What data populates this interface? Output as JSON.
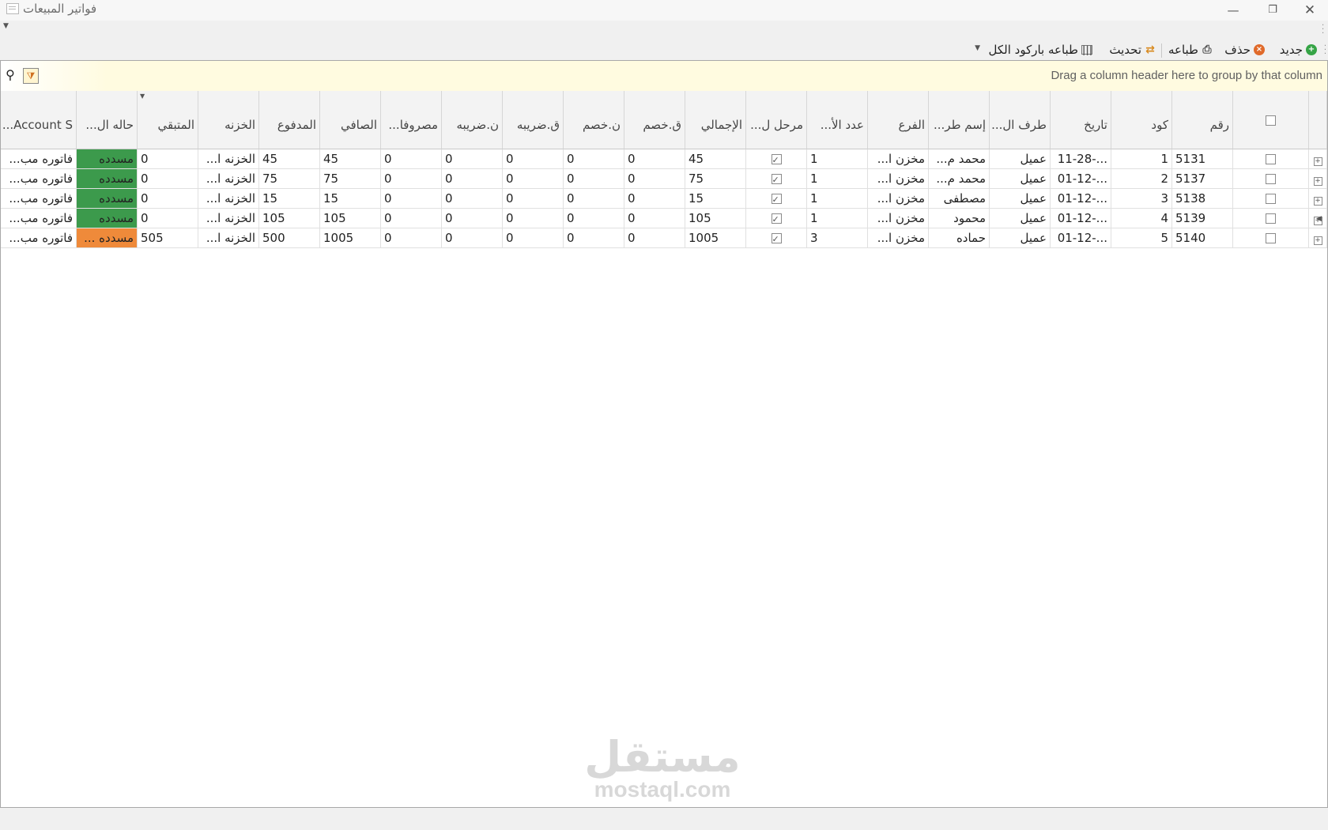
{
  "window": {
    "title": "فواتير المبيعات"
  },
  "toolbar": {
    "new": "جديد",
    "delete": "حذف",
    "print": "طباعه",
    "refresh": "تحديث",
    "barcode_all": "طباعه باركود الكل"
  },
  "grid": {
    "group_hint": "Drag a column header here to group by that column",
    "columns": [
      "رقم",
      "كود",
      "تاريخ",
      "طرف ال...",
      "إسم طر...",
      "الفرع",
      "عدد الأ...",
      "مرحل ل...",
      "الإجمالي",
      "ق.خصم",
      "ن.خصم",
      "ق.ضريبه",
      "ن.ضريبه",
      "مصروفا...",
      "الصافي",
      "المدفوع",
      "الخزنه",
      "المتبقي",
      "حاله ال...",
      "Account S..."
    ],
    "rows": [
      {
        "number": "5131",
        "code": "1",
        "date": "11-28-...",
        "party": "عميل",
        "party_name": "محمد م...",
        "branch": "مخزن ا...",
        "count": "1",
        "posted": true,
        "total": "45",
        "disc_val": "0",
        "disc_pct": "0",
        "tax_val": "0",
        "tax_pct": "0",
        "expenses": "0",
        "net": "45",
        "paid": "45",
        "treasury": "الخزنه ا...",
        "remaining": "0",
        "status": "مسدده",
        "status_color": "#3c9a4c",
        "account": "فاتوره مب..."
      },
      {
        "number": "5137",
        "code": "2",
        "date": "01-12-...",
        "party": "عميل",
        "party_name": "محمد م...",
        "branch": "مخزن ا...",
        "count": "1",
        "posted": true,
        "total": "75",
        "disc_val": "0",
        "disc_pct": "0",
        "tax_val": "0",
        "tax_pct": "0",
        "expenses": "0",
        "net": "75",
        "paid": "75",
        "treasury": "الخزنه ا...",
        "remaining": "0",
        "status": "مسدده",
        "status_color": "#3c9a4c",
        "account": "فاتوره مب..."
      },
      {
        "number": "5138",
        "code": "3",
        "date": "01-12-...",
        "party": "عميل",
        "party_name": "مصطفى",
        "branch": "مخزن ا...",
        "count": "1",
        "posted": true,
        "total": "15",
        "disc_val": "0",
        "disc_pct": "0",
        "tax_val": "0",
        "tax_pct": "0",
        "expenses": "0",
        "net": "15",
        "paid": "15",
        "treasury": "الخزنه ا...",
        "remaining": "0",
        "status": "مسدده",
        "status_color": "#3c9a4c",
        "account": "فاتوره مب..."
      },
      {
        "number": "5139",
        "code": "4",
        "date": "01-12-...",
        "party": "عميل",
        "party_name": "محمود",
        "branch": "مخزن ا...",
        "count": "1",
        "posted": true,
        "total": "105",
        "disc_val": "0",
        "disc_pct": "0",
        "tax_val": "0",
        "tax_pct": "0",
        "expenses": "0",
        "net": "105",
        "paid": "105",
        "treasury": "الخزنه ا...",
        "remaining": "0",
        "status": "مسدده",
        "status_color": "#3c9a4c",
        "account": "فاتوره مب..."
      },
      {
        "number": "5140",
        "code": "5",
        "date": "01-12-...",
        "party": "عميل",
        "party_name": "حماده",
        "branch": "مخزن ا...",
        "count": "3",
        "posted": true,
        "total": "1005",
        "disc_val": "0",
        "disc_pct": "0",
        "tax_val": "0",
        "tax_pct": "0",
        "expenses": "0",
        "net": "1005",
        "paid": "500",
        "treasury": "الخزنه ا...",
        "remaining": "505",
        "status": "مسدده ...",
        "status_color": "#ef8a3a",
        "account": "فاتوره مب..."
      }
    ]
  },
  "watermark": {
    "arabic": "مستقل",
    "latin": "mostaql.com"
  }
}
